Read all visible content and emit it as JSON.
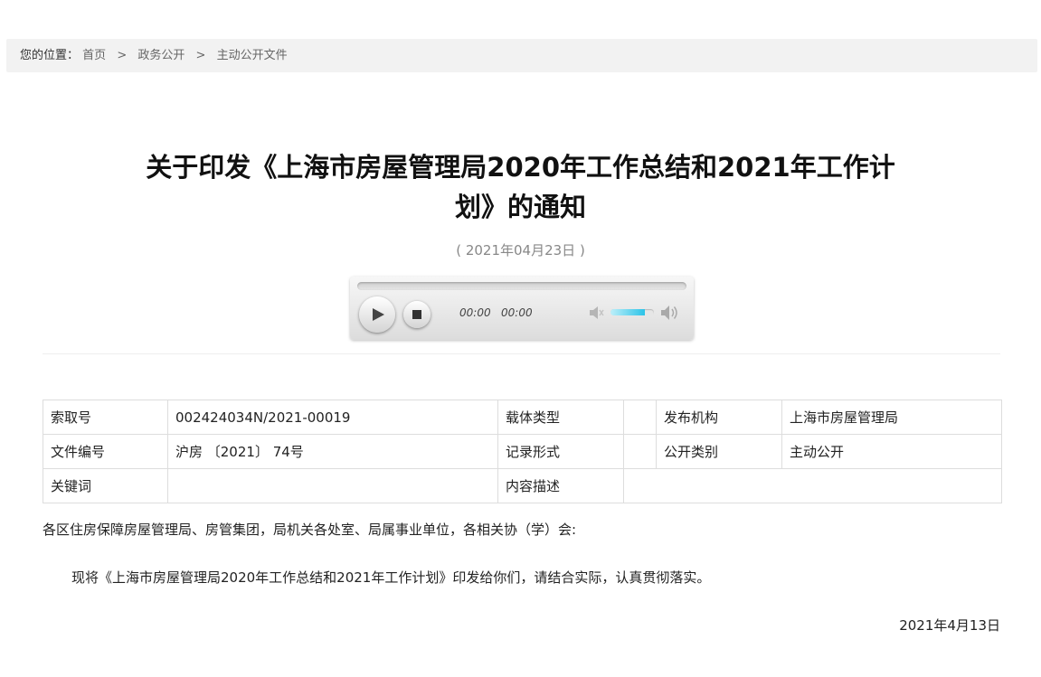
{
  "breadcrumb": {
    "label": "您的位置：",
    "separator": ">",
    "items": [
      "首页",
      "政务公开",
      "主动公开文件"
    ]
  },
  "article": {
    "title_line1": "关于印发《上海市房屋管理局2020年工作总结和2021年工作计",
    "title_line2": "划》的通知",
    "date": "( 2021年04月23日 )"
  },
  "player": {
    "current_time": "00:00",
    "duration": "00:00",
    "progress_fraction": 0,
    "volume_fraction": 0.8,
    "play_icon": "play-icon",
    "stop_icon": "stop-icon",
    "mute_icon": "speaker-mute-icon",
    "max_volume_icon": "speaker-max-icon",
    "accent_color": "#2bc3e8"
  },
  "meta": {
    "rows": [
      [
        "索取号",
        "002424034N/2021-00019",
        "载体类型",
        "",
        "发布机构",
        "上海市房屋管理局"
      ],
      [
        "文件编号",
        "沪房 〔2021〕 74号",
        "记录形式",
        "",
        "公开类别",
        "主动公开"
      ],
      [
        "关键词",
        "",
        "内容描述",
        ""
      ]
    ]
  },
  "content": {
    "addressee": "各区住房保障房屋管理局、房管集团，局机关各处室、局属事业单位，各相关协（学）会:",
    "paragraph": "现将《上海市房屋管理局2020年工作总结和2021年工作计划》印发给你们，请结合实际，认真贯彻落实。",
    "sign_date": "2021年4月13日"
  }
}
